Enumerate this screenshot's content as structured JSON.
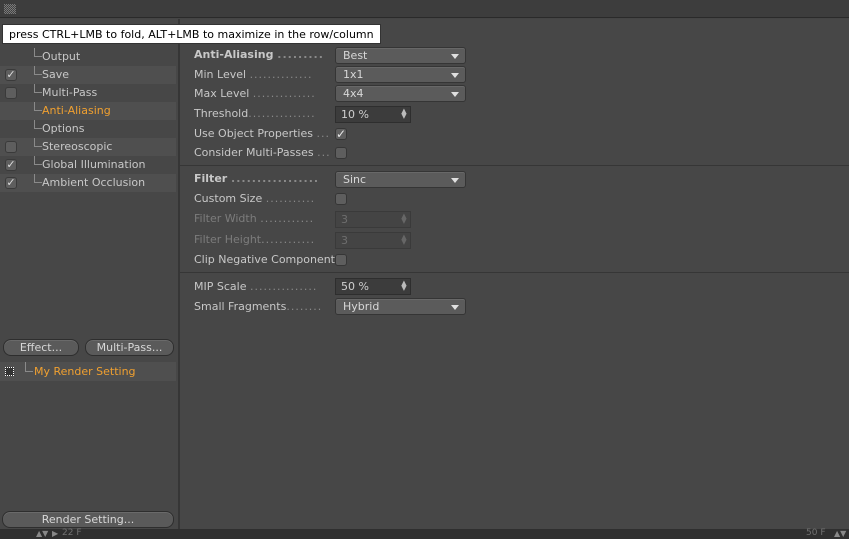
{
  "tooltip": "press CTRL+LMB to fold, ALT+LMB to maximize in the row/column",
  "left_panel": {
    "items": [
      {
        "label": "Output",
        "checked": null,
        "active": false
      },
      {
        "label": "Save",
        "checked": true,
        "active": false
      },
      {
        "label": "Multi-Pass",
        "checked": false,
        "active": false
      },
      {
        "label": "Anti-Aliasing",
        "checked": null,
        "active": true
      },
      {
        "label": "Options",
        "checked": null,
        "active": false
      },
      {
        "label": "Stereoscopic",
        "checked": false,
        "active": false
      },
      {
        "label": "Global Illumination",
        "checked": true,
        "active": false
      },
      {
        "label": "Ambient Occlusion",
        "checked": true,
        "active": false
      }
    ],
    "effect_button": "Effect...",
    "multipass_button": "Multi-Pass...",
    "render_setting_item": "My Render Setting",
    "render_setting_button": "Render Setting..."
  },
  "antialiasing": {
    "title_label": "Anti-Aliasing",
    "title_value": "Best",
    "min_level_label": "Min Level",
    "min_level_value": "1x1",
    "max_level_label": "Max Level",
    "max_level_value": "4x4",
    "threshold_label": "Threshold",
    "threshold_value": "10 %",
    "use_object_props_label": "Use Object Properties",
    "use_object_props_checked": true,
    "consider_multipasses_label": "Consider Multi-Passes",
    "consider_multipasses_checked": false
  },
  "filter": {
    "title_label": "Filter",
    "title_value": "Sinc",
    "custom_size_label": "Custom Size",
    "custom_size_checked": false,
    "filter_width_label": "Filter Width",
    "filter_width_value": "3",
    "filter_height_label": "Filter Height",
    "filter_height_value": "3",
    "clip_negative_label": "Clip Negative Component",
    "clip_negative_checked": false
  },
  "mip": {
    "mip_scale_label": "MIP Scale",
    "mip_scale_value": "50 %",
    "small_fragments_label": "Small Fragments",
    "small_fragments_value": "Hybrid"
  },
  "timeline": {
    "start": "22 F",
    "end": "50 F"
  },
  "colors": {
    "accent": "#f0a030",
    "panel": "#474747"
  }
}
